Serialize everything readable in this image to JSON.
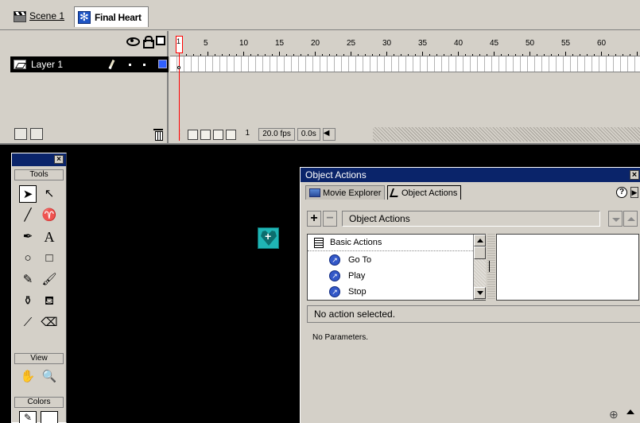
{
  "scenebar": {
    "scene_label": "Scene 1",
    "symbol_label": "Final Heart",
    "scene_icon": "scene-icon",
    "symbol_icon": "movie-clip-symbol-icon"
  },
  "timeline": {
    "header_icons": [
      "eye-icon",
      "lock-icon",
      "outline-icon"
    ],
    "layer": {
      "name": "Layer 1",
      "color": "#3060ff"
    },
    "ruler_numbers": [
      "1",
      "5",
      "10",
      "15",
      "20",
      "25",
      "30",
      "35",
      "40",
      "45",
      "50",
      "55",
      "60"
    ],
    "current_frame": "1",
    "frame_rate": "20.0 fps",
    "elapsed_time": "0.0s"
  },
  "toolbox": {
    "tools_label": "Tools",
    "view_label": "View",
    "colors_label": "Colors",
    "close_label": "×"
  },
  "object_actions": {
    "title": "Object Actions",
    "tabs": [
      {
        "label": "Movie Explorer",
        "active": false
      },
      {
        "label": "Object Actions",
        "active": true
      }
    ],
    "help_label": "?",
    "toolbar_label": "Object Actions",
    "plus_label": "+",
    "minus_label": "−",
    "list": {
      "group": "Basic Actions",
      "items": [
        "Go To",
        "Play",
        "Stop"
      ]
    },
    "status": "No action selected.",
    "params": "No Parameters."
  },
  "colors": {
    "title_bar": "#0a246a",
    "stage": "#000000",
    "layer_highlight": "#000000",
    "playhead": "#ff0000",
    "symbol": "#1fb5b5"
  }
}
